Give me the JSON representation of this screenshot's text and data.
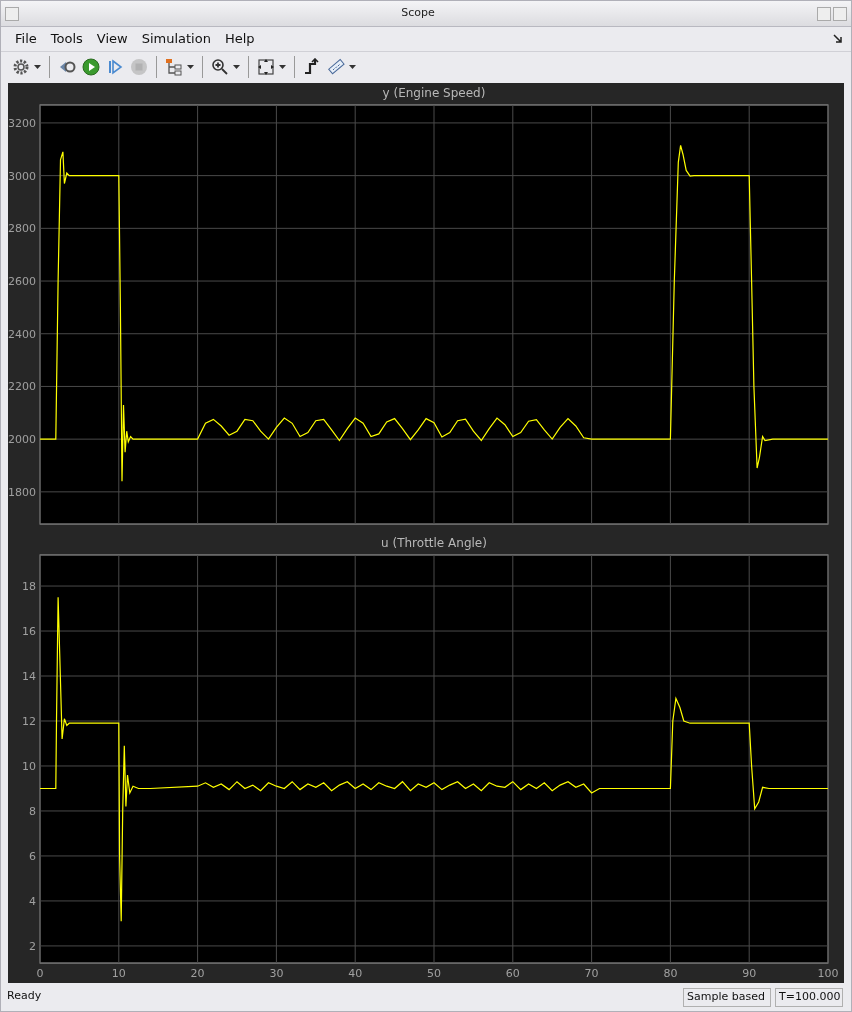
{
  "window": {
    "title": "Scope"
  },
  "menu": [
    {
      "label": "File"
    },
    {
      "label": "Tools"
    },
    {
      "label": "View"
    },
    {
      "label": "Simulation"
    },
    {
      "label": "Help"
    }
  ],
  "toolbar": [
    {
      "dropdown": true,
      "disabled": false
    },
    {
      "dropdown": false,
      "disabled": false
    },
    {
      "dropdown": false,
      "disabled": false
    },
    {
      "dropdown": false,
      "disabled": false
    },
    {
      "dropdown": false,
      "disabled": true
    },
    {
      "dropdown": true,
      "disabled": false
    },
    {
      "dropdown": true,
      "disabled": false
    },
    {
      "dropdown": true,
      "disabled": false
    },
    {
      "dropdown": false,
      "disabled": false
    },
    {
      "dropdown": true,
      "disabled": false
    }
  ],
  "plots": [
    {
      "chart_data": {
        "type": "line",
        "title": "y (Engine Speed)",
        "xlim": [
          0,
          100
        ],
        "ylim": [
          1678,
          3268
        ],
        "grid": true,
        "yticks": [
          1800,
          2000,
          2200,
          2400,
          2600,
          2800,
          3000,
          3200
        ],
        "x": [
          0,
          2,
          2.3,
          2.6,
          2.9,
          3.1,
          3.4,
          3.7,
          4,
          5,
          10,
          10.2,
          10.4,
          10.6,
          10.8,
          11,
          11.2,
          11.5,
          11.8,
          12,
          14,
          20,
          21,
          22,
          23,
          24,
          25,
          26,
          27,
          28,
          29,
          30,
          31,
          32,
          33,
          34,
          35,
          36,
          37,
          38,
          39,
          40,
          41,
          42,
          43,
          44,
          45,
          46,
          47,
          48,
          49,
          50,
          51,
          52,
          53,
          54,
          55,
          56,
          57,
          58,
          59,
          60,
          61,
          62,
          63,
          64,
          65,
          66,
          67,
          68,
          69,
          70,
          71,
          80,
          80.5,
          81,
          81.3,
          81.6,
          82,
          82.5,
          83,
          85,
          90,
          90.3,
          90.6,
          91,
          91.3,
          91.7,
          92,
          93,
          100
        ],
        "series": [
          {
            "color": "#ffff00",
            "values": [
              2000,
              2000,
              2600,
              3060,
              3090,
              2970,
              3010,
              3000,
              3000,
              3000,
              3000,
              2500,
              1840,
              2130,
              1950,
              2030,
              1990,
              2010,
              2000,
              2000,
              2000,
              2000,
              2060,
              2075,
              2050,
              2015,
              2030,
              2075,
              2070,
              2030,
              2000,
              2045,
              2080,
              2060,
              2010,
              2025,
              2070,
              2075,
              2035,
              1995,
              2040,
              2080,
              2060,
              2010,
              2020,
              2065,
              2078,
              2040,
              1998,
              2035,
              2078,
              2062,
              2008,
              2025,
              2070,
              2076,
              2030,
              1995,
              2040,
              2080,
              2055,
              2010,
              2025,
              2068,
              2074,
              2035,
              2000,
              2045,
              2078,
              2050,
              2005,
              2000,
              2000,
              2000,
              2600,
              3050,
              3115,
              3080,
              3020,
              2998,
              3000,
              3000,
              3000,
              2600,
              2200,
              1890,
              1930,
              2010,
              1995,
              2000,
              2000
            ]
          }
        ]
      }
    },
    {
      "chart_data": {
        "type": "line",
        "title": "u (Throttle Angle)",
        "xlim": [
          0,
          100
        ],
        "ylim": [
          1.24,
          19.38
        ],
        "grid": true,
        "xticks": [
          0,
          10,
          20,
          30,
          40,
          50,
          60,
          70,
          80,
          90,
          100
        ],
        "yticks": [
          2,
          4,
          6,
          8,
          10,
          12,
          14,
          16,
          18
        ],
        "x": [
          0,
          2,
          2.1,
          2.3,
          2.5,
          2.8,
          3.1,
          3.4,
          3.7,
          4,
          10,
          10.1,
          10.3,
          10.5,
          10.7,
          10.9,
          11.1,
          11.4,
          11.8,
          12.5,
          14,
          20,
          21,
          22,
          23,
          24,
          25,
          26,
          27,
          28,
          29,
          30,
          31,
          32,
          33,
          34,
          35,
          36,
          37,
          38,
          39,
          40,
          41,
          42,
          43,
          44,
          45,
          46,
          47,
          48,
          49,
          50,
          51,
          52,
          53,
          54,
          55,
          56,
          57,
          58,
          59,
          60,
          61,
          62,
          63,
          64,
          65,
          66,
          67,
          68,
          69,
          70,
          71,
          80,
          80.3,
          80.7,
          81.2,
          81.7,
          82.5,
          90,
          90.3,
          90.7,
          91.2,
          91.7,
          92.5,
          100
        ],
        "series": [
          {
            "color": "#ffff00",
            "values": [
              9,
              9,
              12,
              17.5,
              15,
              11.2,
              12.1,
              11.8,
              11.9,
              11.9,
              11.9,
              6,
              3.1,
              8,
              10.9,
              8.2,
              9.6,
              8.8,
              9.1,
              9,
              9,
              9.1,
              9.25,
              9.05,
              9.2,
              8.95,
              9.3,
              9.0,
              9.15,
              8.9,
              9.25,
              9.1,
              9.0,
              9.3,
              8.95,
              9.2,
              9.05,
              9.25,
              8.9,
              9.15,
              9.3,
              9.0,
              9.2,
              8.95,
              9.25,
              9.1,
              9.0,
              9.3,
              8.9,
              9.2,
              9.05,
              9.25,
              8.95,
              9.15,
              9.3,
              9.0,
              9.2,
              8.9,
              9.25,
              9.1,
              9.05,
              9.3,
              8.95,
              9.2,
              9.0,
              9.25,
              8.9,
              9.15,
              9.3,
              9.05,
              9.2,
              8.8,
              9,
              9,
              12,
              13,
              12.6,
              12,
              11.9,
              11.9,
              10,
              8.1,
              8.4,
              9.05,
              9,
              9
            ]
          }
        ]
      }
    }
  ],
  "status_bar": {
    "message": "Ready",
    "mode": "Sample based",
    "time": "T=100.000"
  }
}
